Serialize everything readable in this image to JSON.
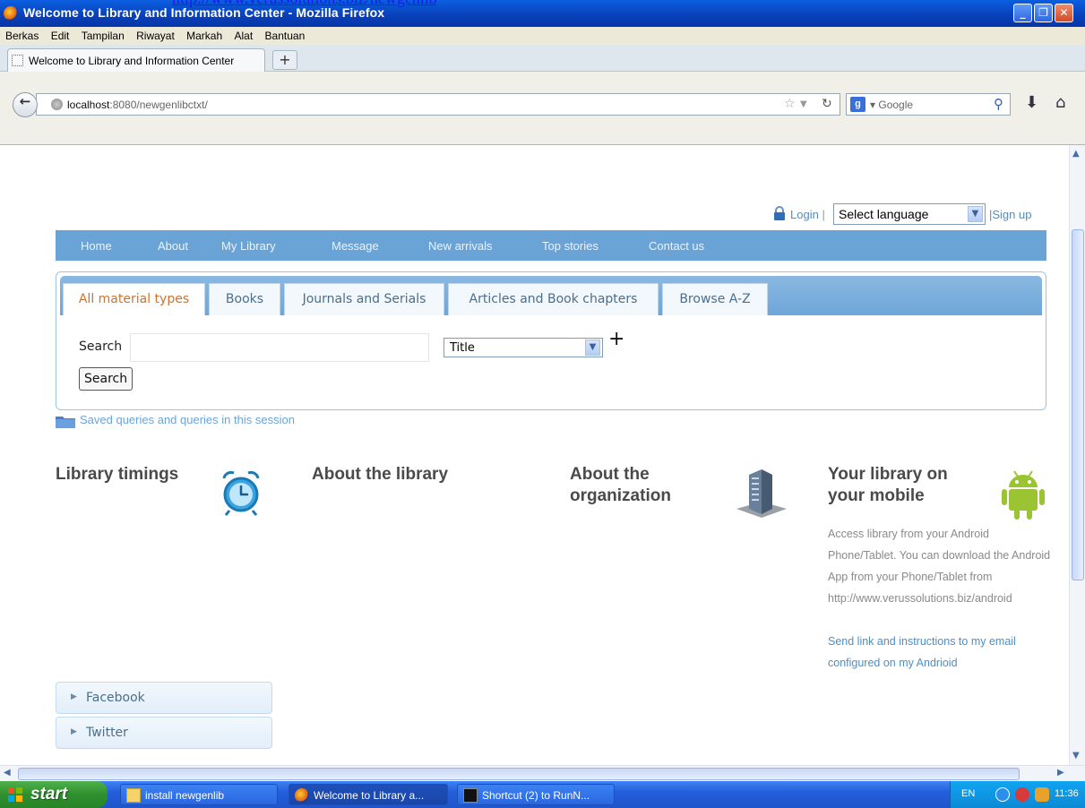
{
  "window": {
    "title": "Welcome to Library and Information Center - Mozilla Firefox",
    "top_url_fragment": "http://www.verussolutions.biz/newgenlib"
  },
  "menu": [
    "Berkas",
    "Edit",
    "Tampilan",
    "Riwayat",
    "Markah",
    "Alat",
    "Bantuan"
  ],
  "browser_tab": {
    "label": "Welcome to Library and Information Center",
    "new_tab": "+"
  },
  "navbar": {
    "url_host": "localhost",
    "url_rest": ":8080/newgenlibctxt/",
    "search_engine": "Google"
  },
  "header": {
    "login": "Login",
    "separator": "|",
    "language_select": "Select language",
    "signup": "|Sign up"
  },
  "mainnav": [
    "Home",
    "About",
    "My Library",
    "Message",
    "New arrivals",
    "Top stories",
    "Contact us"
  ],
  "search": {
    "tabs": [
      "All material types",
      "Books",
      "Journals and Serials",
      "Articles and Book chapters",
      "Browse A-Z"
    ],
    "label": "Search",
    "input_value": "",
    "field_select": "Title",
    "add_field": "+",
    "button": "Search",
    "saved_queries": "Saved queries and queries in this session"
  },
  "sections": {
    "timings": "Library timings",
    "about": "About the library",
    "organization": "About the organization",
    "mobile": "Your library on your mobile",
    "mobile_text": "Access library from your Android Phone/Tablet. You can download the Android App from your Phone/Tablet from http://www.verussolutions.biz/android",
    "mobile_link": "Send link and instructions to my email configured on my Andrioid"
  },
  "social": [
    "Facebook",
    "Twitter"
  ],
  "taskbar": {
    "start": "start",
    "tasks": [
      "install newgenlib",
      "Welcome to Library a...",
      "Shortcut (2) to RunN..."
    ],
    "lang": "EN",
    "clock": "11:36"
  },
  "colors": {
    "nav": "#6aa4d6",
    "active_tab": "#d1722a",
    "link": "#4a8fc9",
    "taskbar": "#245edb"
  }
}
